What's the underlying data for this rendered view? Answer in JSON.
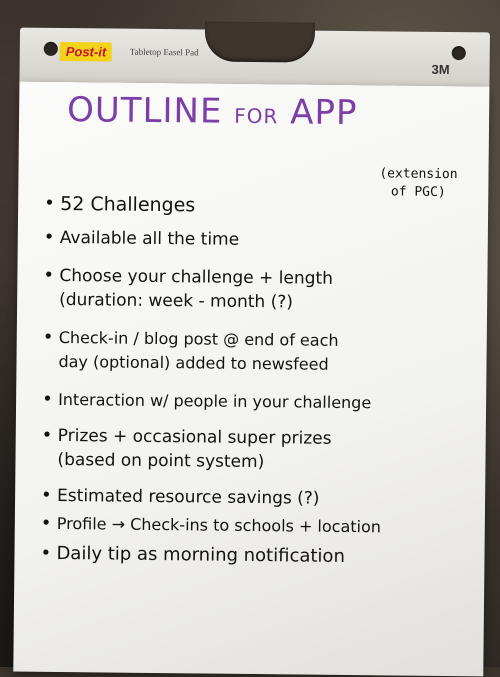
{
  "header": {
    "logo_text": "Post-it",
    "product_text": "Tabletop Easel Pad",
    "brand_text": "3M"
  },
  "title": {
    "main": "OUTLINE",
    "connector": "FOR",
    "last": "APP",
    "note_line1": "(extension",
    "note_line2": "of PGC)",
    "color": "#7b3fa6"
  },
  "items": [
    {
      "line1": "52 Challenges"
    },
    {
      "line1": "Available all the time"
    },
    {
      "line1": "Choose your challenge + length",
      "line2": "(duration: week - month (?)"
    },
    {
      "line1": "Check-in / blog post @ end of each",
      "line2": "day (optional) added to newsfeed"
    },
    {
      "line1": "Interaction w/ people in your challenge"
    },
    {
      "line1": "Prizes + occasional super prizes",
      "line2": "(based on point system)"
    },
    {
      "line1": "Estimated resource savings (?)"
    },
    {
      "line1": "Profile → Check-ins to schools + location"
    },
    {
      "line1": "Daily tip as morning notification"
    }
  ]
}
